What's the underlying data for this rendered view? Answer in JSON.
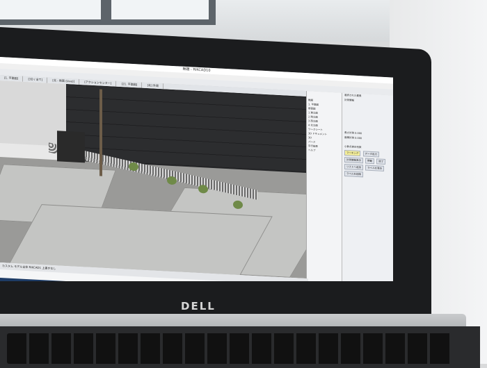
{
  "app": {
    "title": "無題 - RIKCAD10"
  },
  "tabs": [
    "[1. 平面図]",
    "[3D / 全て]",
    "[北 - 断面 (Live)]",
    "[アクションセンター]",
    "[21. 平面図]",
    "[北] 外周"
  ],
  "navigator": {
    "items": [
      "無題",
      "1. 平面図",
      "断面図",
      "1 東立面",
      "2 南立面",
      "3 西立面",
      "4 北立面",
      "ワークシート",
      "3D ドキュメント",
      "3D",
      "パース",
      "平行投影",
      "ヘルプ"
    ]
  },
  "info_panel": {
    "lines": [
      "選択された要素",
      "計測情報",
      "長さ計測",
      "面積計測",
      "小数点表示桁数"
    ],
    "values": [
      "0.000",
      "0.000"
    ],
    "buttons": [
      "マーキング",
      "データ出力",
      "計測情報表示",
      "移動",
      "終了",
      "リストへ追加",
      "ラベルを表示",
      "ラベルを削除"
    ]
  },
  "statusbar": {
    "text": "カスタム   モデル全体   RIKCAD1   上書きなし"
  },
  "brand": {
    "logo": "DELL"
  },
  "colors": {
    "accent": "#1e3c66",
    "highlight": "#f4ee9a"
  }
}
